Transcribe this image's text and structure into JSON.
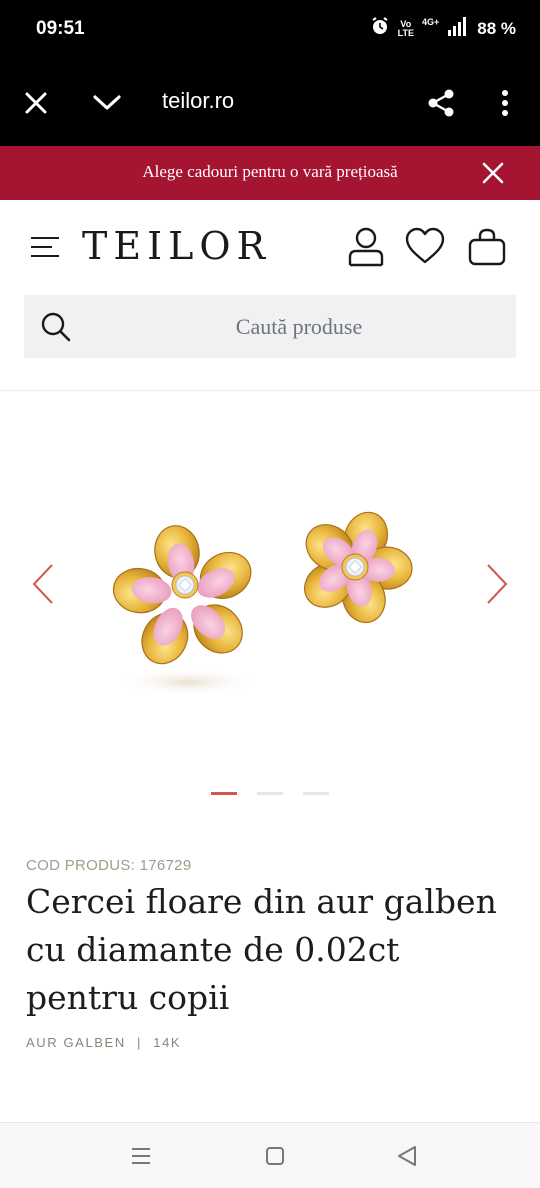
{
  "status": {
    "time": "09:51",
    "volte_line1": "Vo",
    "volte_line2": "LTE",
    "network": "4G+",
    "battery": "88 %"
  },
  "browser": {
    "url": "teilor.ro",
    "icons": [
      "close-icon",
      "chevron-down-icon",
      "share-icon",
      "more-vertical-icon"
    ]
  },
  "promo": {
    "text": "Alege cadouri pentru o vară prețioasă",
    "background": "#a51431"
  },
  "header": {
    "logo": "TEILOR",
    "icons": [
      "menu-icon",
      "account-icon",
      "wishlist-heart-icon",
      "shopping-bag-icon"
    ]
  },
  "search": {
    "placeholder": "Caută produse"
  },
  "gallery": {
    "slide_count": 3,
    "active_slide": 1,
    "accent": "#d4574b"
  },
  "product": {
    "code": "COD PRODUS: 176729",
    "title": "Cercei floare din aur galben cu diamante de 0.02ct pentru copii",
    "metal": "AUR GALBEN",
    "separator": "|",
    "karat": "14K"
  },
  "navbar": {
    "icons": [
      "recent-apps-icon",
      "home-icon",
      "back-icon"
    ]
  }
}
